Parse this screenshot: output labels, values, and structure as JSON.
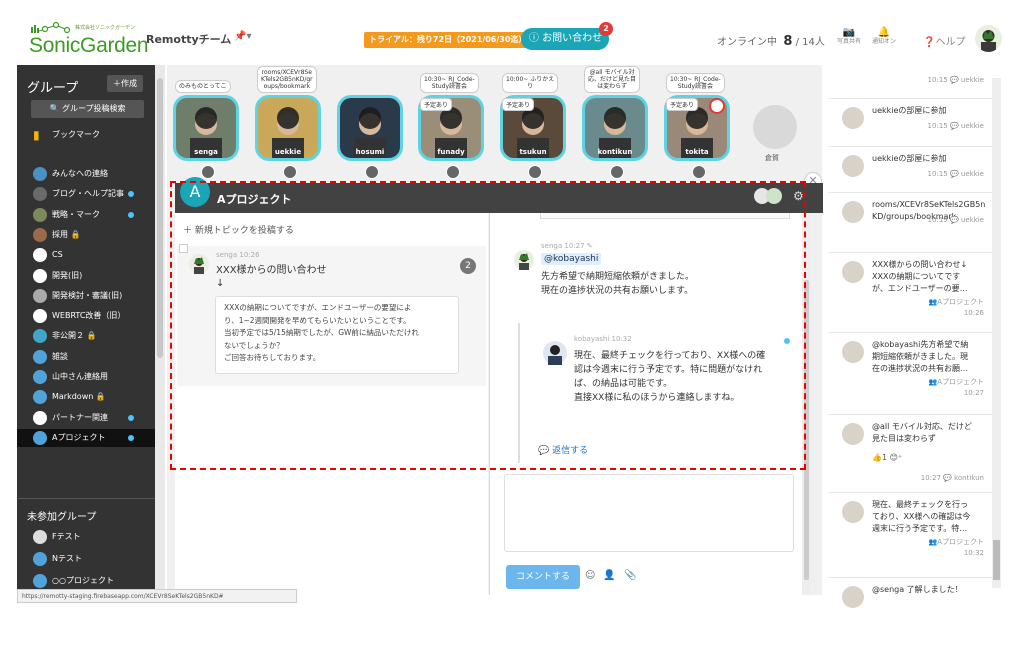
{
  "header": {
    "logo_small": "株式会社ソニックガーデン",
    "logo_text": "SonicGarden",
    "team_name": "Remottyチーム",
    "mark_label": "📌▾",
    "trial_text": "トライアル：残り72日（2021/06/30迄）",
    "inquiry_label": "お問い合わせ",
    "inquiry_badge": "2",
    "online_label": "オンライン中",
    "online_count": "8",
    "online_total": "/ 14人",
    "photo_label": "写真共有",
    "notify_label": "通知オン",
    "help_label": "ヘルプ"
  },
  "sidebar": {
    "title": "グループ",
    "create_label": "＋作成",
    "search_label": "🔍 グループ投稿検索",
    "bookmark_label": "ブックマーク",
    "items": [
      {
        "label": "みんなへの連絡",
        "dot": false
      },
      {
        "label": "ブログ・ヘルプ記事",
        "dot": true
      },
      {
        "label": "戦略・マーク",
        "dot": true
      },
      {
        "label": "採用 🔒",
        "dot": false
      },
      {
        "label": "CS",
        "dot": false
      },
      {
        "label": "開発(旧)",
        "dot": false
      },
      {
        "label": "開発検討・審議(旧)",
        "dot": false
      },
      {
        "label": "WEBRTC改善（旧）",
        "dot": false
      },
      {
        "label": "非公開２ 🔒",
        "dot": false
      },
      {
        "label": "雑談",
        "dot": false
      },
      {
        "label": "山中さん連絡用",
        "dot": false
      },
      {
        "label": "Markdown 🔒",
        "dot": false
      },
      {
        "label": "パートナー関連",
        "dot": true
      },
      {
        "label": "Aプロジェクト",
        "dot": true
      }
    ],
    "unjoined_title": "未参加グループ",
    "unjoined": [
      {
        "label": "Fテスト"
      },
      {
        "label": "Nテスト"
      },
      {
        "label": "○○プロジェクト"
      }
    ],
    "status_url": "https://remotty-staging.firebaseapp.com/XCEVr8SeKTels2GB5nKD#"
  },
  "rooms": [
    {
      "name": "senga",
      "bubble": "のみものとってこ",
      "tag": ""
    },
    {
      "name": "uekkie",
      "bubble": "rooms/XCEVr8Se\nKTels2GB5nKD/gr\noups/bookmark",
      "tag": ""
    },
    {
      "name": "hosumi",
      "bubble": "",
      "tag": ""
    },
    {
      "name": "funady",
      "bubble": "10:30~ RJ_Code-\nStudy読書会",
      "tag": "予定あり"
    },
    {
      "name": "tsukun",
      "bubble": "10:00~ ふりかえ\nり",
      "tag": "予定あり"
    },
    {
      "name": "kontikun",
      "bubble": "@all モバイル対\n応、だけど見た目\nは変わらず",
      "tag": ""
    },
    {
      "name": "tokita",
      "bubble": "10:30~ RJ_Code-\nStudy読書会",
      "tag": "予定あり"
    },
    {
      "name": "倉賀",
      "bubble": "",
      "tag": ""
    }
  ],
  "project": {
    "avatar_letter": "A",
    "title": "Aプロジェクト",
    "new_topic": "＋ 新規トピックを投稿する",
    "topic": {
      "author": "senga",
      "time": "10:26",
      "title": "XXX様からの問い合わせ\n↓",
      "count": "2",
      "body": "XXXの納期についてですが、エンドユーザーの要望によ\nり、1~2週間開発を早めてもらいたいということです。\n当初予定では5/15納期でしたが、GW前に納品いただけれ\nないでしょうか？\nご回答お待ちしております。"
    },
    "comment": {
      "author": "senga",
      "time": "10:27 ✎",
      "mention": "@kobayashi",
      "body": "先方希望で納期短縮依頼がきました。\n現在の進捗状況の共有お願いします。"
    },
    "reply": {
      "author": "kobayashi",
      "time": "10:32",
      "body": "現在、最終チェックを行っており、XX様への確\n認は今週末に行う予定です。特に問題がなけれ\nば、の納品は可能です。\n直接XX様に私のほうから連絡しますね。",
      "reply_label": "💬 返信する"
    },
    "comment_button": "コメントする"
  },
  "feed": [
    {
      "text": "",
      "meta": "10:15 💬 uekkie"
    },
    {
      "text": "uekkieの部屋に参加",
      "meta": "10:15 💬 uekkie"
    },
    {
      "text": "uekkieの部屋に参加",
      "meta": "10:15 💬 uekkie"
    },
    {
      "text": "rooms/XCEVr8SeKTels2GB5nKD/groups/bookmark",
      "meta": "10:19 💬 uekkie"
    },
    {
      "text": "XXX様からの問い合わせ↓\nXXXの納期についてです\nが、エンドユーザーの要…",
      "meta": "👥Aプロジェクト\n10:26"
    },
    {
      "text": "@kobayashi先方希望で納\n期短縮依頼がきました。現\n在の進捗状況の共有お願…",
      "meta": "👥Aプロジェクト\n10:27"
    },
    {
      "text": "@all モバイル対応、だけど\n見た目は変わらず",
      "meta": "10:27 💬 kontikun",
      "reactions": "👍1  😊⁺"
    },
    {
      "text": "現在、最終チェックを行っ\nており、XX様への確認は今\n週末に行う予定です。特…",
      "meta": "👥Aプロジェクト\n10:32"
    },
    {
      "text": "@senga 了解しました！",
      "meta": ""
    }
  ]
}
